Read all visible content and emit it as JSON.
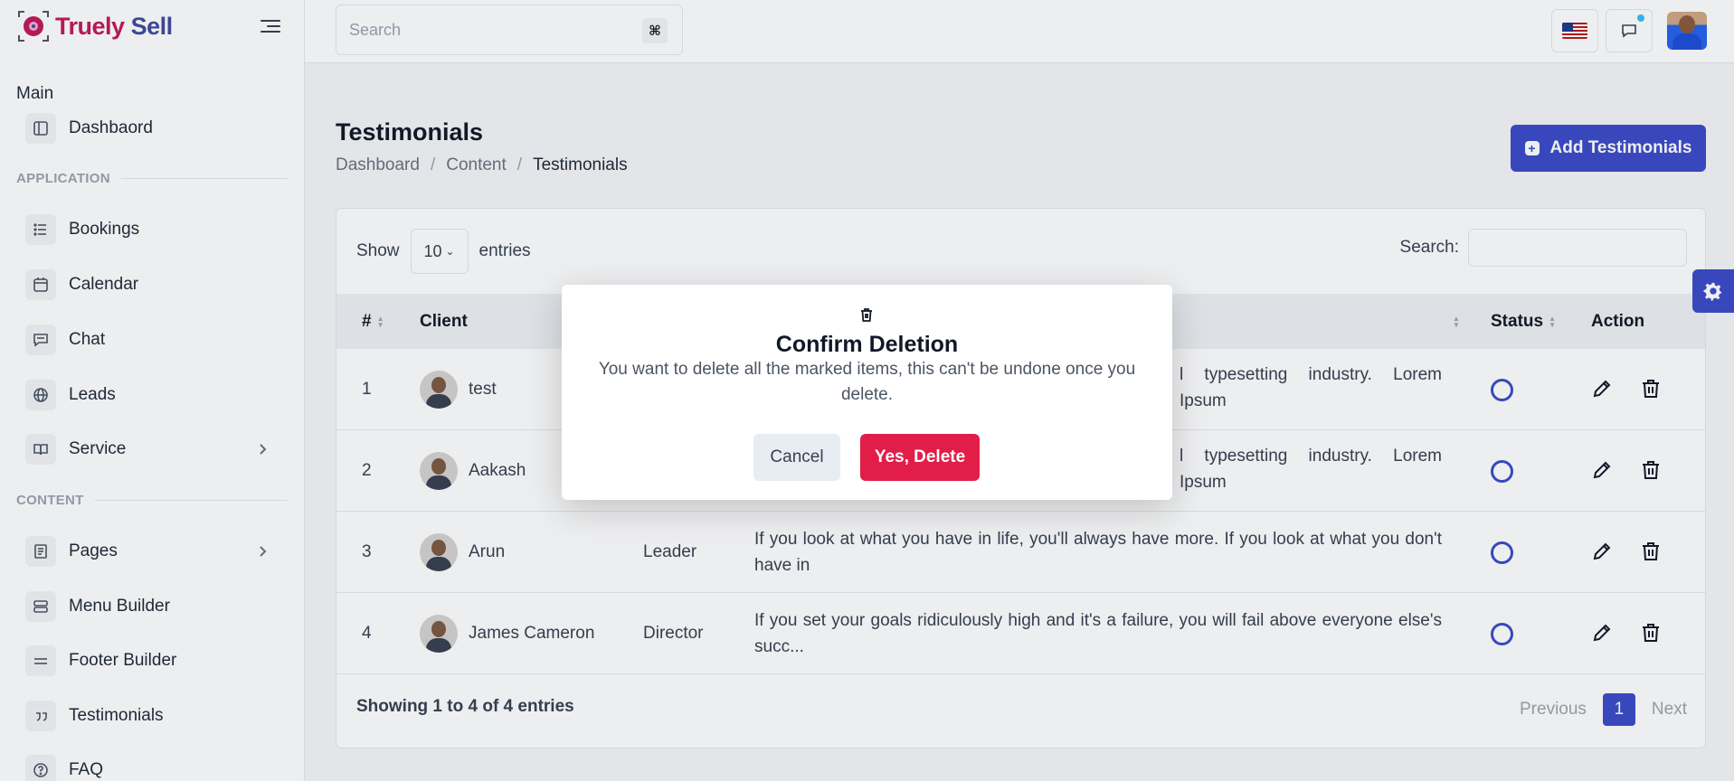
{
  "brand": {
    "part1": "Truely",
    "part2": "Sell"
  },
  "sidebar": {
    "main_label": "Main",
    "application_label": "APPLICATION",
    "content_label": "CONTENT",
    "items": [
      {
        "label": "Dashbaord",
        "icon": "sidebar-layout-icon"
      },
      {
        "label": "Bookings",
        "icon": "list-icon"
      },
      {
        "label": "Calendar",
        "icon": "calendar-icon"
      },
      {
        "label": "Chat",
        "icon": "chat-icon"
      },
      {
        "label": "Leads",
        "icon": "globe-icon"
      },
      {
        "label": "Service",
        "icon": "book-icon"
      },
      {
        "label": "Pages",
        "icon": "page-icon"
      },
      {
        "label": "Menu Builder",
        "icon": "menu-builder-icon"
      },
      {
        "label": "Footer Builder",
        "icon": "footer-icon"
      },
      {
        "label": "Testimonials",
        "icon": "quote-icon"
      },
      {
        "label": "FAQ",
        "icon": "help-circle-icon"
      }
    ]
  },
  "topbar": {
    "search_placeholder": "Search",
    "shortcut": "⌘"
  },
  "page": {
    "title": "Testimonials",
    "breadcrumb": [
      "Dashboard",
      "Content",
      "Testimonials"
    ],
    "add_button": "Add Testimonials"
  },
  "table": {
    "show_label": "Show",
    "entries_value": "10",
    "entries_label": "entries",
    "search_label": "Search:",
    "headers": {
      "num": "#",
      "client": "Client",
      "status": "Status",
      "action": "Action"
    },
    "rows": [
      {
        "num": "1",
        "client": "test",
        "designation": "",
        "message": "l typesetting industry. Lorem Ipsum"
      },
      {
        "num": "2",
        "client": "Aakash",
        "designation": "",
        "message": "l typesetting industry. Lorem Ipsum"
      },
      {
        "num": "3",
        "client": "Arun",
        "designation": "Leader",
        "message": "If you look at what you have in life, you'll always have more. If you look at what you don't have in"
      },
      {
        "num": "4",
        "client": "James Cameron",
        "designation": "Director",
        "message": "If you set your goals ridiculously high and it's a failure, you will fail above everyone else's succ..."
      }
    ],
    "footer": "Showing 1 to 4 of 4 entries",
    "pagination": {
      "previous": "Previous",
      "page": "1",
      "next": "Next"
    }
  },
  "modal": {
    "title": "Confirm Deletion",
    "message": "You want to delete all the marked items, this can't be undone once you delete.",
    "cancel": "Cancel",
    "confirm": "Yes, Delete"
  },
  "colors": {
    "primary": "#3b4bc8",
    "danger": "#e11d48",
    "brand_pink": "#c2185b"
  }
}
